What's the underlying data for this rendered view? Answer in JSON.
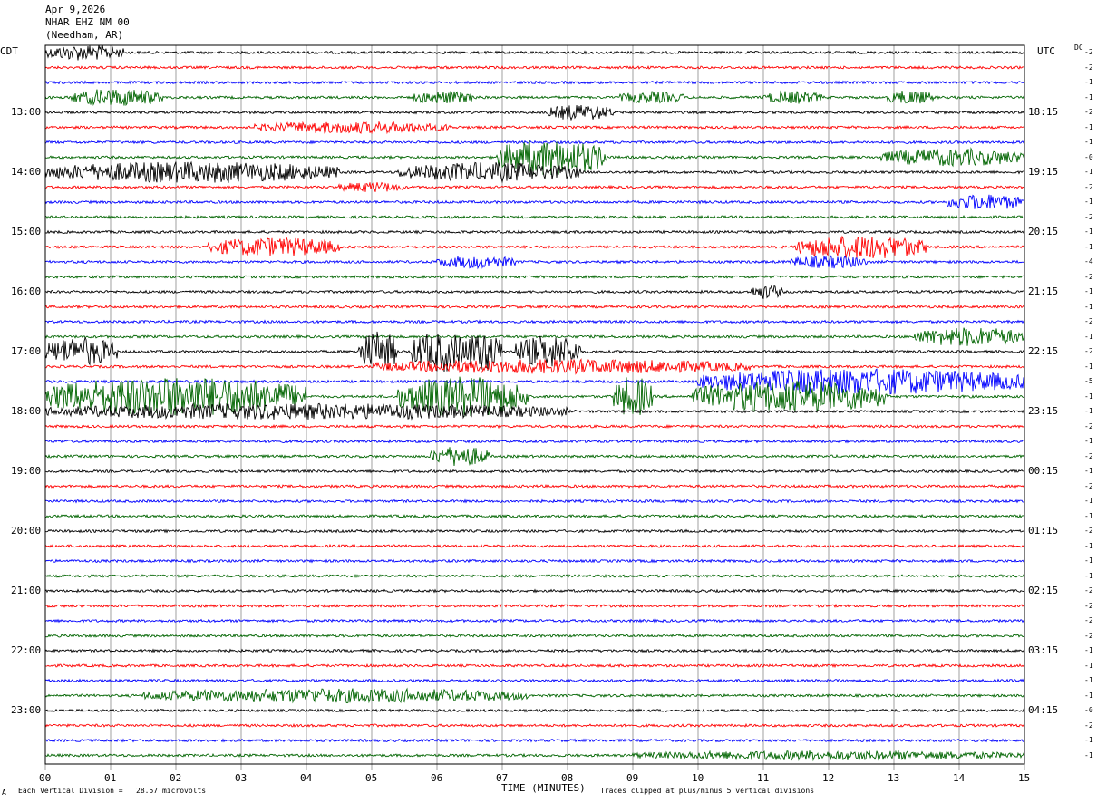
{
  "header": {
    "date": "Apr 9,2026",
    "station": "NHAR EHZ NM 00",
    "location": "(Needham, AR)"
  },
  "labels": {
    "left_tz": "CDT",
    "right_tz": "UTC",
    "right_top": "DC",
    "xlabel": "TIME (MINUTES)",
    "footer_scale": "Each Vertical Division =   28.57 microvolts",
    "footer_clip": "Traces clipped at plus/minus 5 vertical divisions",
    "footer_mark": "A"
  },
  "chart_data": {
    "type": "line",
    "title": "",
    "xlabel": "TIME (MINUTES)",
    "xlim": [
      0,
      15
    ],
    "x_ticks": [
      "00",
      "01",
      "02",
      "03",
      "04",
      "05",
      "06",
      "07",
      "08",
      "09",
      "10",
      "11",
      "12",
      "13",
      "14",
      "15"
    ],
    "rows": 48,
    "row_minutes": 15,
    "trace_colors": [
      "#000000",
      "#ff0000",
      "#0000ff",
      "#006400"
    ],
    "left_hour_labels": [
      {
        "row": 4,
        "label": "13:00"
      },
      {
        "row": 8,
        "label": "14:00"
      },
      {
        "row": 12,
        "label": "15:00"
      },
      {
        "row": 16,
        "label": "16:00"
      },
      {
        "row": 20,
        "label": "17:00"
      },
      {
        "row": 24,
        "label": "18:00"
      },
      {
        "row": 28,
        "label": "19:00"
      },
      {
        "row": 32,
        "label": "20:00"
      },
      {
        "row": 36,
        "label": "21:00"
      },
      {
        "row": 40,
        "label": "22:00"
      },
      {
        "row": 44,
        "label": "23:00"
      }
    ],
    "right_hour_labels": [
      {
        "row": 4,
        "label": "18:15"
      },
      {
        "row": 8,
        "label": "19:15"
      },
      {
        "row": 12,
        "label": "20:15"
      },
      {
        "row": 16,
        "label": "21:15"
      },
      {
        "row": 20,
        "label": "22:15"
      },
      {
        "row": 24,
        "label": "23:15"
      },
      {
        "row": 28,
        "label": "00:15"
      },
      {
        "row": 32,
        "label": "01:15"
      },
      {
        "row": 36,
        "label": "02:15"
      },
      {
        "row": 40,
        "label": "03:15"
      },
      {
        "row": 44,
        "label": "04:15"
      }
    ],
    "dc_offsets": [
      "-2",
      "-2",
      "-1",
      "-1",
      "-2",
      "-1",
      "-1",
      "-0",
      "-1",
      "-2",
      "-1",
      "-2",
      "-1",
      "-1",
      "-4",
      "-2",
      "-1",
      "-1",
      "-2",
      "-1",
      "-2",
      "-1",
      "-5",
      "-1",
      "-1",
      "-2",
      "-1",
      "-2",
      "-1",
      "-2",
      "-1",
      "-1",
      "-2",
      "-1",
      "-1",
      "-1",
      "-2",
      "-2",
      "-2",
      "-2",
      "-1",
      "-1",
      "-1",
      "-1",
      "-0",
      "-2",
      "-1",
      "-1"
    ],
    "events": [
      {
        "row": 0,
        "x0": 0,
        "x1": 1.2,
        "amp": 2.0
      },
      {
        "row": 3,
        "x0": 0.4,
        "x1": 1.8,
        "amp": 2.2
      },
      {
        "row": 3,
        "x0": 5.6,
        "x1": 6.6,
        "amp": 1.6
      },
      {
        "row": 3,
        "x0": 8.8,
        "x1": 9.8,
        "amp": 1.5
      },
      {
        "row": 3,
        "x0": 11.0,
        "x1": 11.9,
        "amp": 1.6
      },
      {
        "row": 3,
        "x0": 12.9,
        "x1": 13.6,
        "amp": 1.8
      },
      {
        "row": 4,
        "x0": 7.7,
        "x1": 8.7,
        "amp": 2.0
      },
      {
        "row": 5,
        "x0": 3.2,
        "x1": 6.2,
        "amp": 1.5
      },
      {
        "row": 7,
        "x0": 6.9,
        "x1": 8.6,
        "amp": 4.5
      },
      {
        "row": 7,
        "x0": 12.8,
        "x1": 15.0,
        "amp": 2.2
      },
      {
        "row": 8,
        "x0": 0.0,
        "x1": 4.5,
        "amp": 2.6
      },
      {
        "row": 8,
        "x0": 5.4,
        "x1": 8.2,
        "amp": 2.4
      },
      {
        "row": 9,
        "x0": 4.5,
        "x1": 5.5,
        "amp": 1.3
      },
      {
        "row": 10,
        "x0": 13.8,
        "x1": 15.0,
        "amp": 2.0
      },
      {
        "row": 13,
        "x0": 2.5,
        "x1": 4.5,
        "amp": 2.4
      },
      {
        "row": 13,
        "x0": 11.5,
        "x1": 13.5,
        "amp": 3.0
      },
      {
        "row": 14,
        "x0": 6.0,
        "x1": 7.2,
        "amp": 1.6
      },
      {
        "row": 14,
        "x0": 11.4,
        "x1": 12.6,
        "amp": 1.6
      },
      {
        "row": 16,
        "x0": 10.8,
        "x1": 11.3,
        "amp": 1.8
      },
      {
        "row": 19,
        "x0": 13.3,
        "x1": 15.0,
        "amp": 2.4
      },
      {
        "row": 20,
        "x0": 0.0,
        "x1": 1.1,
        "amp": 3.5
      },
      {
        "row": 20,
        "x0": 4.8,
        "x1": 5.4,
        "amp": 5.0
      },
      {
        "row": 20,
        "x0": 5.6,
        "x1": 6.5,
        "amp": 5.0
      },
      {
        "row": 20,
        "x0": 6.4,
        "x1": 7.0,
        "amp": 5.0
      },
      {
        "row": 20,
        "x0": 7.2,
        "x1": 8.2,
        "amp": 4.0
      },
      {
        "row": 21,
        "x0": 5.0,
        "x1": 10.8,
        "amp": 1.8
      },
      {
        "row": 22,
        "x0": 10.0,
        "x1": 15.0,
        "amp": 3.2
      },
      {
        "row": 23,
        "x0": 0.0,
        "x1": 4.0,
        "amp": 5.0
      },
      {
        "row": 23,
        "x0": 5.4,
        "x1": 7.4,
        "amp": 5.0
      },
      {
        "row": 23,
        "x0": 8.7,
        "x1": 9.3,
        "amp": 5.0
      },
      {
        "row": 23,
        "x0": 9.9,
        "x1": 12.9,
        "amp": 4.0
      },
      {
        "row": 24,
        "x0": 0.0,
        "x1": 8.0,
        "amp": 2.0
      },
      {
        "row": 27,
        "x0": 5.9,
        "x1": 6.8,
        "amp": 2.5
      },
      {
        "row": 43,
        "x0": 1.5,
        "x1": 7.4,
        "amp": 1.8
      },
      {
        "row": 47,
        "x0": 9.0,
        "x1": 15.0,
        "amp": 1.2
      }
    ]
  }
}
